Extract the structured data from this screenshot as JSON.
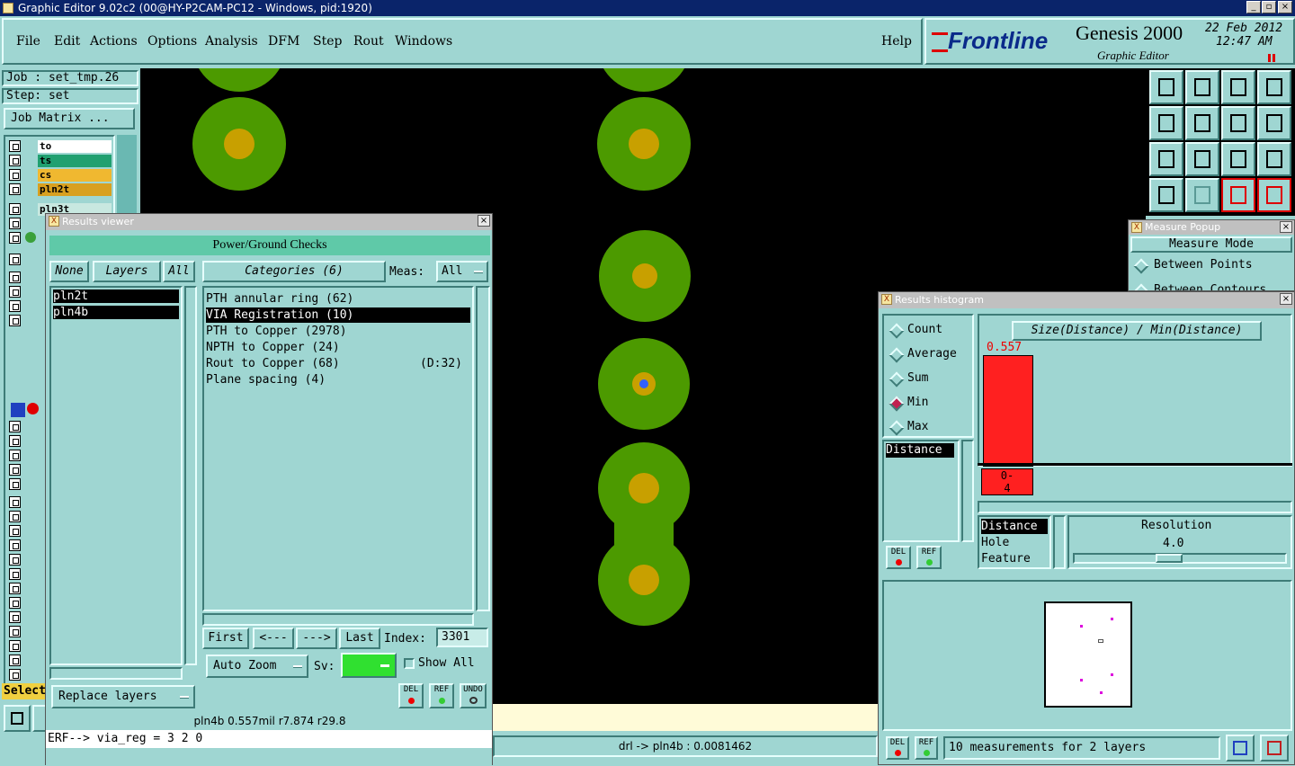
{
  "window": {
    "title": "Graphic Editor 9.02c2 (00@HY-P2CAM-PC12 - Windows, pid:1920)",
    "min": "_",
    "max": "▫",
    "close": "×"
  },
  "menu": {
    "items": [
      "File",
      "Edit",
      "Actions",
      "Options",
      "Analysis",
      "DFM",
      "Step",
      "Rout",
      "Windows"
    ],
    "help": "Help"
  },
  "brand": {
    "logo": "Frontline",
    "product": "Genesis 2000",
    "subtitle": "Graphic Editor",
    "date": "22 Feb 2012",
    "time": "12:47 AM"
  },
  "job": {
    "job_label": "Job : set_tmp.26",
    "step_label": "Step: set",
    "matrix_button": "Job Matrix ..."
  },
  "layers": {
    "top": [
      {
        "name": "to",
        "color": "#ffffff"
      },
      {
        "name": "ts",
        "color": "#20a070"
      },
      {
        "name": "cs",
        "color": "#f0b830"
      },
      {
        "name": "pln2t",
        "color": "#d8a020"
      }
    ],
    "next": "pln3t",
    "select_label": "Select"
  },
  "results_viewer": {
    "title": "Results viewer",
    "header": "Power/Ground Checks",
    "none_btn": "None",
    "layers_btn": "Layers",
    "all_btn": "All",
    "layer_list": [
      "pln2t",
      "pln4b"
    ],
    "categories_btn": "Categories (6)",
    "meas_label": "Meas:",
    "meas_value": "All",
    "categories": [
      {
        "label": "PTH annular ring (62)",
        "extra": ""
      },
      {
        "label": "VIA Registration (10)",
        "extra": ""
      },
      {
        "label": "PTH to Copper (2978)",
        "extra": ""
      },
      {
        "label": "NPTH to Copper (24)",
        "extra": ""
      },
      {
        "label": "Rout to Copper (68)",
        "extra": "(D:32)"
      },
      {
        "label": "Plane spacing (4)",
        "extra": ""
      }
    ],
    "nav": {
      "first": "First",
      "prev": "<---",
      "next": "--->",
      "last": "Last",
      "index_label": "Index:",
      "index_value": "3301"
    },
    "auto_zoom": "Auto Zoom",
    "sv_label": "Sv:",
    "show_all": "Show All",
    "replace_layers": "Replace layers",
    "del": "DEL",
    "ref": "REF",
    "undo": "UNDO",
    "status": "pln4b  0.557mil   r7.874  r29.8",
    "erf": "ERF--> via_reg = 3 2 0"
  },
  "canvas_status": "drl -> pln4b : 0.0081462",
  "measure_popup": {
    "title": "Measure Popup",
    "mode_label": "Measure Mode",
    "between_points": "Between Points",
    "between_contours": "Between Contours"
  },
  "histogram": {
    "title": "Results histogram",
    "options": [
      "Count",
      "Average",
      "Sum",
      "Min",
      "Max"
    ],
    "selected_option": "Min",
    "field_list": [
      "Distance"
    ],
    "chart_title": "Size(Distance) / Min(Distance)",
    "bar_value": "0.557",
    "bar_range_top": "0-",
    "bar_range_bottom": "4",
    "sort_list": [
      "Distance",
      "Hole",
      "Feature"
    ],
    "resolution_label": "Resolution",
    "resolution_value": "4.0",
    "footer": "10 measurements for 2 layers",
    "del": "DEL",
    "ref": "REF"
  },
  "colors": {
    "panel": "#9fd6d2",
    "header": "#5fc9a8",
    "pad_outer": "#4c9a00",
    "pad_inner": "#c8a000",
    "bar": "#ff2020"
  }
}
